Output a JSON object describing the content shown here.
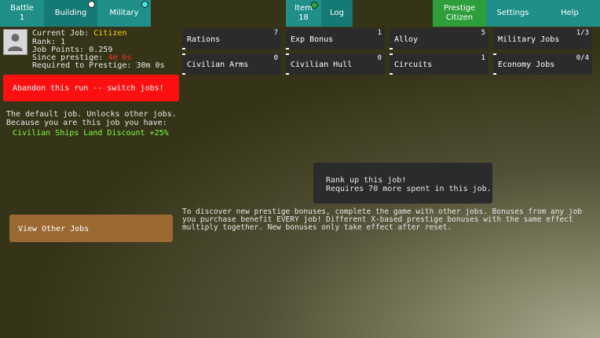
{
  "top_tabs": {
    "battle": {
      "label": "Battle",
      "count": "1"
    },
    "building": {
      "label": "Building"
    },
    "military": {
      "label": "Military"
    },
    "item": {
      "label": "Item",
      "count": "18"
    },
    "log": {
      "label": "Log"
    },
    "prestige": {
      "label": "Prestige",
      "sub": "Citizen"
    },
    "settings": {
      "label": "Settings"
    },
    "help": {
      "label": "Help"
    }
  },
  "job_info": {
    "current_job_label": "Current Job:",
    "current_job_value": "Citizen",
    "rank": "Rank: 1",
    "job_points": "Job Points: 0.259",
    "since_prestige_label": "Since prestige:",
    "since_prestige_value": "4m 6s",
    "required_label": "Required to Prestige:",
    "required_value": "30m 0s"
  },
  "abandon_button": "Abandon this run -- switch jobs!",
  "description": {
    "line1": "The default job. Unlocks other jobs.",
    "line2": "Because you are this job you have:",
    "bonus": "Civilian Ships Land Discount +25%"
  },
  "view_other_jobs": "View Other Jobs",
  "upgrades": [
    {
      "name": "Rations",
      "count": "7"
    },
    {
      "name": "Exp Bonus",
      "count": "1"
    },
    {
      "name": "Alloy",
      "count": "5"
    },
    {
      "name": "Military Jobs",
      "count": "1/3"
    },
    {
      "name": "Civilian Arms",
      "count": "0"
    },
    {
      "name": "Civilian Hull",
      "count": "0"
    },
    {
      "name": "Circuits",
      "count": "1"
    },
    {
      "name": "Economy Jobs",
      "count": "0/4"
    }
  ],
  "tooltip": {
    "line1": "Rank up this job!",
    "line2": "Requires 70 more spent in this job."
  },
  "footer_text": {
    "line1": "To discover new prestige bonuses, complete the game with other jobs. Bonuses from any job",
    "line2": "you purchase benefit EVERY job! Different X-based prestige bonuses with the same effect",
    "line3": "multiply together. New bonuses only take effect after reset."
  },
  "colors": {
    "tab_teal": "#1f8f88",
    "tab_green": "#2e9e3a",
    "abandon_red": "#ff1010",
    "view_jobs_brown": "#9b6a32",
    "citizen_yellow": "#ffd200",
    "since_prestige_red": "#ff2a2a",
    "bonus_green": "#7dff3a"
  },
  "icons": {
    "job_portrait": "person-silhouette-icon",
    "notify_white": "white-dot-icon",
    "notify_cyan": "cyan-dot-icon",
    "notify_green": "green-dot-icon"
  }
}
